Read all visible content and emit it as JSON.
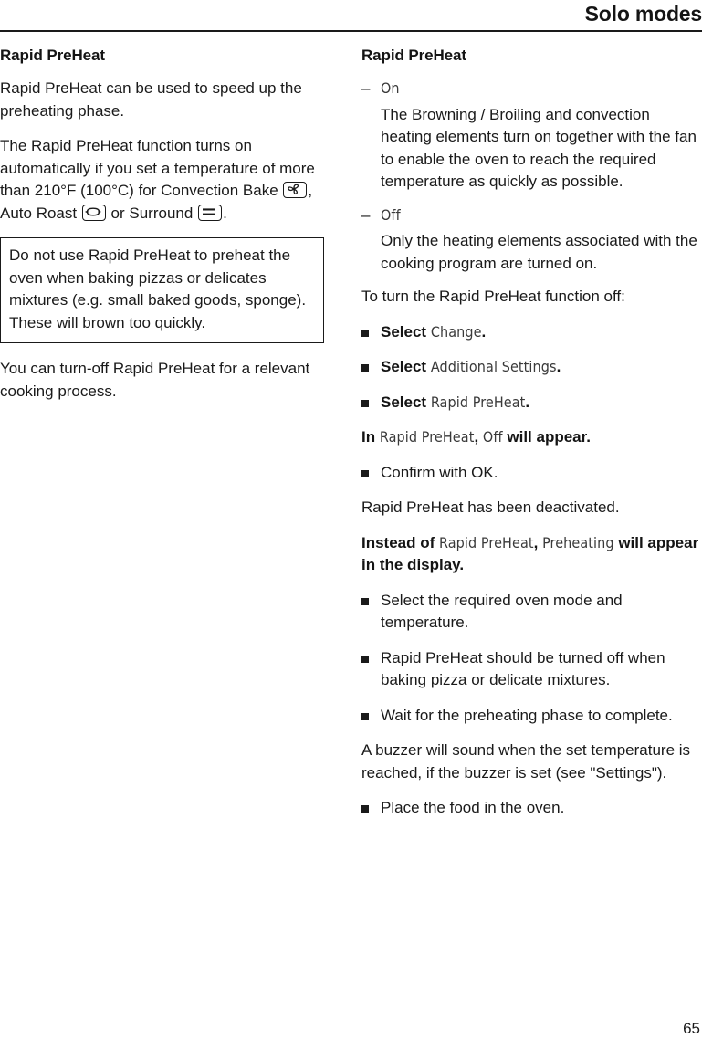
{
  "header": {
    "title": "Solo modes"
  },
  "left_column": {
    "section_title": "Rapid PreHeat",
    "para_1": "Rapid PreHeat can be used to speed up the preheating phase.",
    "para_2": {
      "part_1": "The Rapid PreHeat function turns on automatically if you set a temperature of more than 210°F (100°C) for Convection Bake ",
      "part_2": ", Auto Roast ",
      "part_3": " or Surround ",
      "part_4": "."
    },
    "note_box": {
      "text": "Do not use Rapid PreHeat to preheat the oven when baking pizzas or delicates mixtures (e.g. small baked goods, sponge). These will brown too quickly."
    },
    "para_3": "You can turn-off Rapid PreHeat for a relevant cooking process."
  },
  "right_column": {
    "section_title": "Rapid PreHeat",
    "options": [
      {
        "dash": "–",
        "name": "On",
        "description": "The Browning / Broiling and convection heating elements turn on together with the fan to enable the oven to reach the required temperature as quickly as possible."
      },
      {
        "dash": "–",
        "name": "Off",
        "description": "Only the heating elements associated with the cooking program are turned on."
      }
    ],
    "intro_turn_off": "To turn the Rapid PreHeat function off:",
    "steps_1": [
      {
        "bold_lead": "Select ",
        "ui_text": "Change",
        "tail": "."
      },
      {
        "bold_lead": "Select ",
        "ui_text": "Additional Settings",
        "tail": "."
      },
      {
        "bold_lead": "Select ",
        "ui_text": "Rapid PreHeat",
        "tail": "."
      }
    ],
    "result_line_1": {
      "bold_1": "In ",
      "ui_1": "Rapid PreHeat",
      "bold_2": ", ",
      "ui_2": "Off",
      "bold_3": " will appear."
    },
    "confirm_step": "Confirm with OK.",
    "deactivated_line": "Rapid PreHeat has been deactivated.",
    "result_line_2": {
      "bold_1": "Instead of ",
      "ui_1": "Rapid PreHeat",
      "bold_2": ", ",
      "ui_2": "Preheating",
      "bold_3": " will appear in the display."
    },
    "steps_2": [
      "Select the required oven mode and temperature.",
      "Rapid PreHeat should be turned off when baking pizza or delicate mixtures.",
      "Wait for the preheating phase to complete."
    ],
    "buzzer_note": "A buzzer will sound when the set temperature is reached, if the buzzer is set (see \"Settings\").",
    "final_step": "Place the food in the oven."
  },
  "footer": {
    "page_number": "65"
  },
  "icons": {
    "convection_bake": "fan-icon",
    "auto_roast": "auto-roast-icon",
    "surround": "surround-heat-icon"
  }
}
